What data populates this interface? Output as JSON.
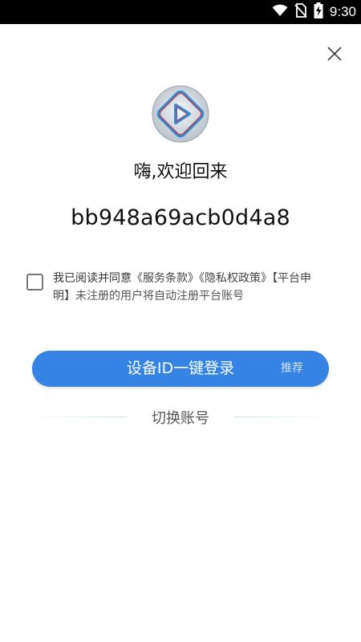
{
  "status_bar": {
    "time": "9:30",
    "icons": [
      "wifi-icon",
      "no-sim-icon",
      "battery-charging-icon"
    ]
  },
  "header": {
    "close_icon": "close-icon"
  },
  "welcome": {
    "title": "嗨,欢迎回来",
    "device_id": "bb948a69acb0d4a8"
  },
  "agreement": {
    "prefix": "我已阅读并同意",
    "service_terms": "《服务条款》",
    "privacy_policy": "《隐私权政策》",
    "platform_statement": "【平台申明】",
    "suffix": "未注册的用户将自动注册平台账号",
    "checked": false
  },
  "login_button": {
    "label": "设备ID一键登录",
    "badge": "推荐",
    "color": "#3584e4"
  },
  "switch_account": {
    "label": "切换账号"
  }
}
